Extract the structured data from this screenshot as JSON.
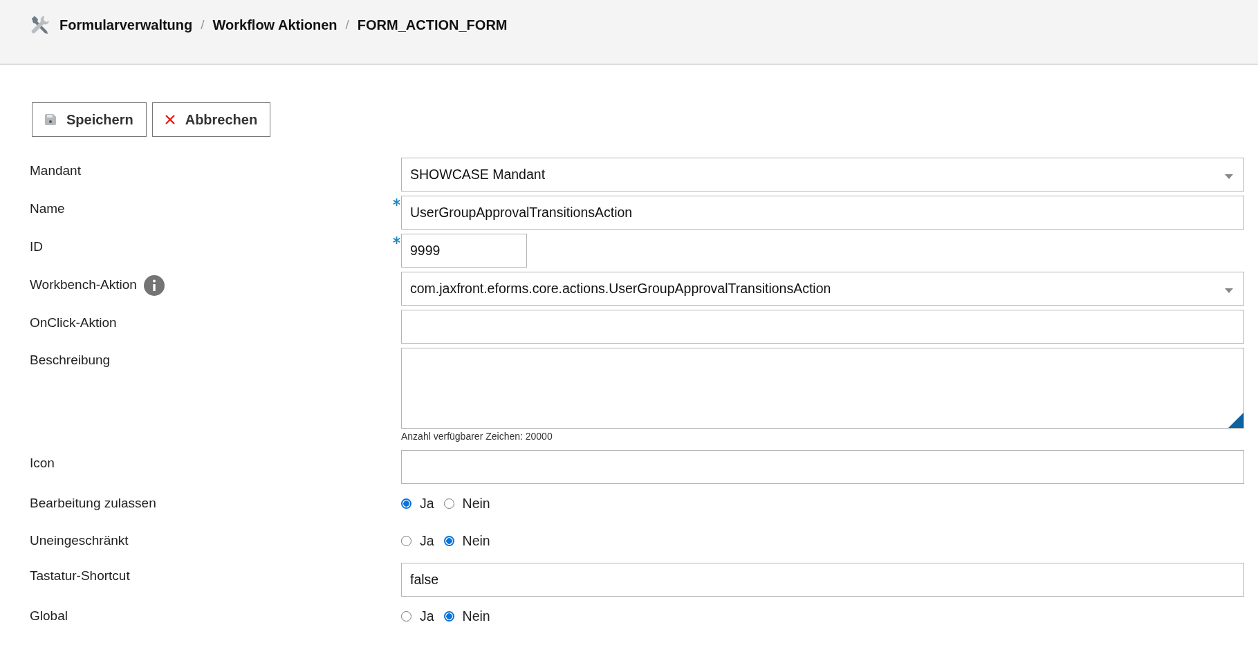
{
  "breadcrumb": [
    {
      "label": "Formularverwaltung"
    },
    {
      "label": "Workflow Aktionen",
      "separator": "/"
    },
    {
      "label": "FORM_ACTION_FORM",
      "separator": "/"
    }
  ],
  "toolbar": [
    {
      "kind": "save",
      "label": "Speichern"
    },
    {
      "kind": "cancel",
      "label": "Abbrechen"
    }
  ],
  "fields": [
    {
      "label": "Mandant",
      "kind": "select",
      "value": "SHOWCASE Mandant",
      "required": false
    },
    {
      "label": "Name",
      "kind": "text",
      "value": "UserGroupApprovalTransitionsAction",
      "required": true
    },
    {
      "label": "ID",
      "kind": "short",
      "value": "9999",
      "required": true
    },
    {
      "label": "Workbench-Aktion",
      "kind": "select",
      "value": "com.jaxfront.eforms.core.actions.UserGroupApprovalTransitionsAction",
      "required": false,
      "info": true
    },
    {
      "label": "OnClick-Aktion",
      "kind": "text",
      "required": false
    },
    {
      "label": "Beschreibung",
      "kind": "textarea",
      "required": false,
      "hint": "Anzahl verfügbarer Zeichen: 20000"
    },
    {
      "label": "Icon",
      "kind": "text",
      "required": false
    },
    {
      "label": "Bearbeitung zulassen",
      "kind": "radio",
      "options": [
        {
          "label": "Ja",
          "selected": true
        },
        {
          "label": "Nein",
          "selected": false
        }
      ]
    },
    {
      "label": "Uneingeschränkt",
      "kind": "radio",
      "options": [
        {
          "label": "Ja",
          "selected": false
        },
        {
          "label": "Nein",
          "selected": true
        }
      ]
    },
    {
      "label": "Tastatur-Shortcut",
      "kind": "text",
      "value": "false",
      "required": false
    },
    {
      "label": "Global",
      "kind": "radio",
      "options": [
        {
          "label": "Ja",
          "selected": false
        },
        {
          "label": "Nein",
          "selected": true
        }
      ]
    }
  ]
}
